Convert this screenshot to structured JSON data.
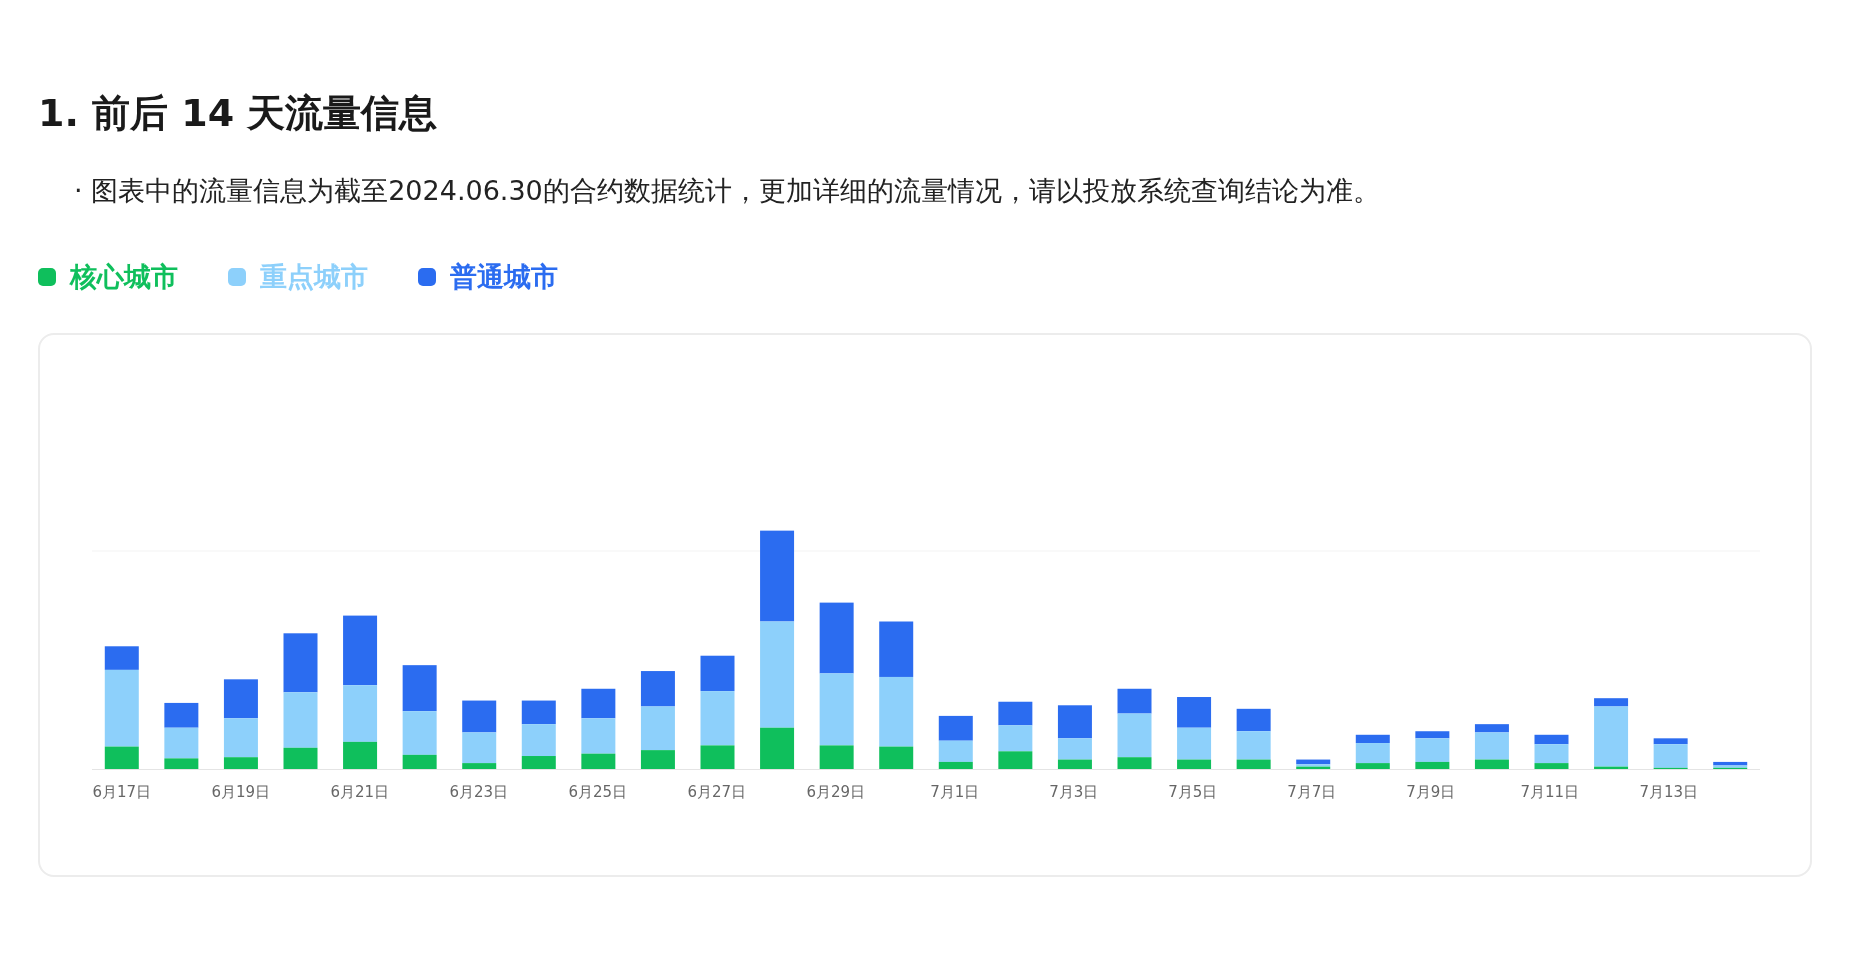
{
  "title": "1. 前后 14 天流量信息",
  "note": "· 图表中的流量信息为截至2024.06.30的合约数据统计，更加详细的流量情况，请以投放系统查询结论为准。",
  "legend": [
    {
      "label": "核心城市",
      "color": "#0fbf5c"
    },
    {
      "label": "重点城市",
      "color": "#8dd0fb"
    },
    {
      "label": "普通城市",
      "color": "#2b6cf0"
    }
  ],
  "chart": {
    "kind": "picture",
    "x_labels": [
      "6月17日",
      "6月19日",
      "6月21日",
      "6月23日",
      "6月25日",
      "6月27日",
      "6月29日",
      "7月1日",
      "7月3日",
      "7月5日",
      "7月7日",
      "7月9日",
      "7月11日",
      "7月13日"
    ]
  }
}
